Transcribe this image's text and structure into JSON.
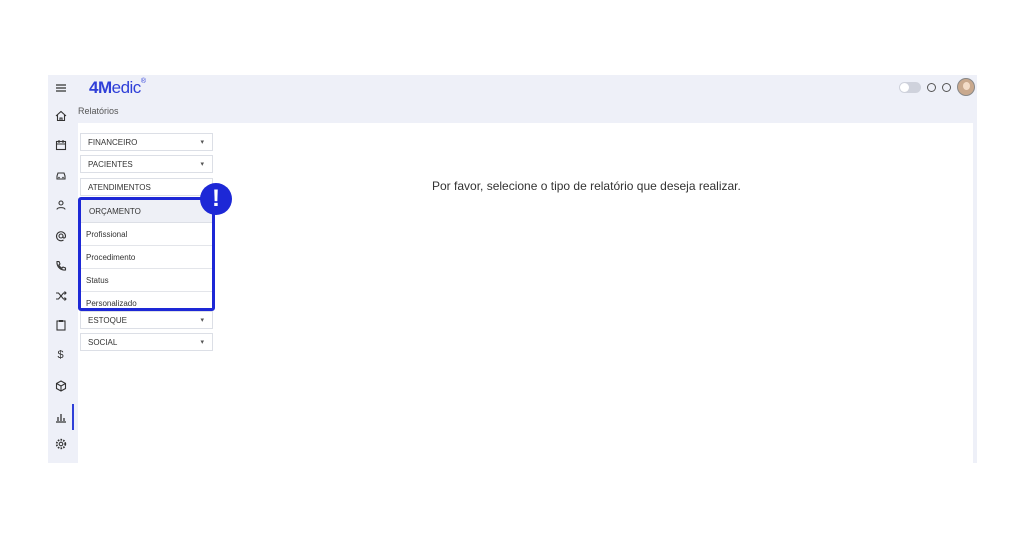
{
  "app": {
    "brand": "4M",
    "brand_rest": "edic",
    "brand_mark": "®"
  },
  "breadcrumb": "Relatórios",
  "sidebar_icons": [
    "menu-icon",
    "home-icon",
    "calendar-icon",
    "car-icon",
    "user-icon",
    "at-icon",
    "phone-icon",
    "shuffle-icon",
    "clipboard-icon",
    "dollar-icon",
    "box-icon",
    "chart-icon",
    "settings-icon"
  ],
  "menu": {
    "items": [
      {
        "label": "FINANCEIRO",
        "chevron": "▾"
      },
      {
        "label": "PACIENTES",
        "chevron": "▾"
      },
      {
        "label": "ATENDIMENTOS"
      }
    ],
    "open": {
      "label": "ORÇAMENTO",
      "items": [
        "Profissional",
        "Procedimento",
        "Status",
        "Personalizado"
      ]
    },
    "after": [
      {
        "label": "ESTOQUE",
        "chevron": "▾"
      },
      {
        "label": "SOCIAL",
        "chevron": "▾"
      }
    ]
  },
  "alert_badge": "!",
  "message": "Por favor, selecione o tipo de relatório que deseja realizar.",
  "sidebar": {
    "dollar": "$"
  },
  "colors": {
    "accent": "#2f3fd8",
    "highlight": "#1d28d6",
    "background": "#eef0f8"
  }
}
